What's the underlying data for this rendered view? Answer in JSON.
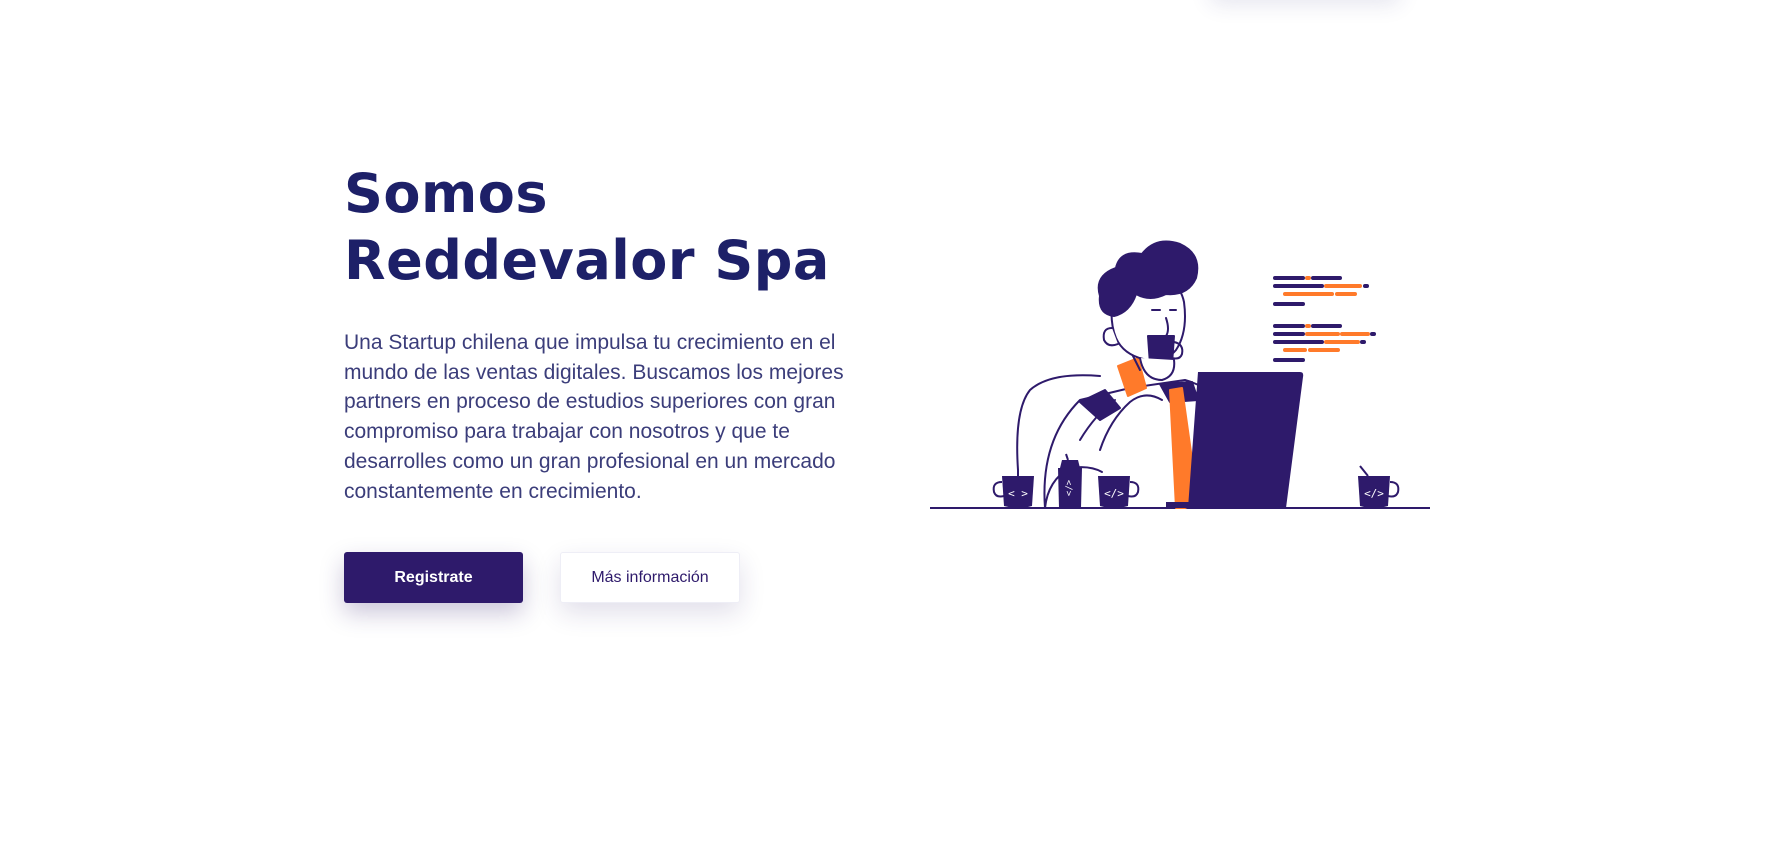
{
  "hero": {
    "title_line1": "Somos",
    "title_line2": "Reddevalor Spa",
    "description": "Una Startup chilena que impulsa tu crecimiento en el mundo de las ventas digitales. Buscamos los mejores partners en proceso de estudios superiores con gran compromiso para trabajar con nosotros y que te desarrolles como un gran profesional en un mercado constantemente en crecimiento."
  },
  "actions": {
    "register_label": "Registrate",
    "more_info_label": "Más información"
  },
  "illustration": {
    "icon": "developer-drinking-coffee-illustration",
    "mug_labels": [
      "< >",
      "</>",
      "</>"
    ],
    "can_label": "</>",
    "colors": {
      "primary": "#2e1a6b",
      "accent": "#ff7a2a",
      "outline": "#2e1a6b"
    }
  },
  "colors": {
    "title": "#1d2068",
    "text": "#3b3d7a",
    "button_primary": "#2e1a6b"
  }
}
